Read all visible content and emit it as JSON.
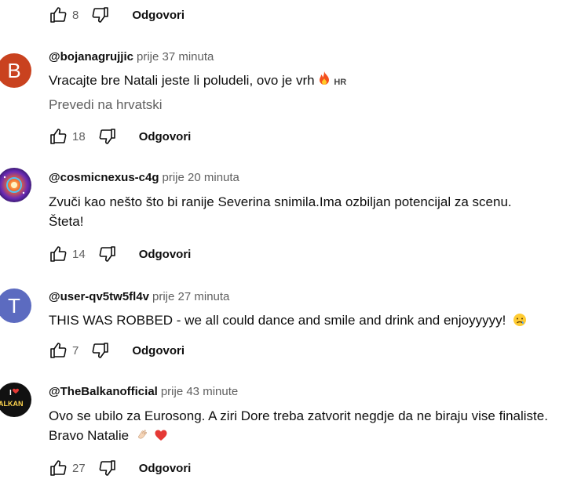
{
  "top_actions": {
    "likes": "8",
    "reply_label": "Odgovori"
  },
  "comments": [
    {
      "avatar_letter": "B",
      "avatar_color": "#c9421f",
      "author": "@bojanagrujjic",
      "time": "prije 37 minuta",
      "text": "Vracajte bre Natali jeste li poludeli, ovo je vrh",
      "lang_badge": "HR",
      "translate_label": "Prevedi na hrvatski",
      "likes": "18",
      "reply_label": "Odgovori"
    },
    {
      "avatar_letter": "",
      "author": "@cosmicnexus-c4g",
      "time": "prije 20 minuta",
      "text_lines": [
        "Zvuči kao nešto što bi ranije Severina snimila.Ima ozbiljan potencijal za scenu.",
        "Šteta!"
      ],
      "likes": "14",
      "reply_label": "Odgovori"
    },
    {
      "avatar_letter": "T",
      "avatar_color": "#5c6bc0",
      "author": "@user-qv5tw5fl4v",
      "time": "prije 27 minuta",
      "text": "THIS WAS ROBBED - we all could dance and smile and drink and enjoyyyyy!",
      "likes": "7",
      "reply_label": "Odgovori"
    },
    {
      "avatar_letter": "",
      "author": "@TheBalkanofficial",
      "time": "prije 43 minute",
      "text_lines": [
        "Ovo se ubilo za Eurosong. A ziri Dore treba zatvorit negdje da ne biraju vise finaliste.",
        "Bravo Natalie"
      ],
      "avatar_logo_text": [
        "I",
        "ALKAN"
      ],
      "likes": "27",
      "reply_label": "Odgovori"
    }
  ]
}
